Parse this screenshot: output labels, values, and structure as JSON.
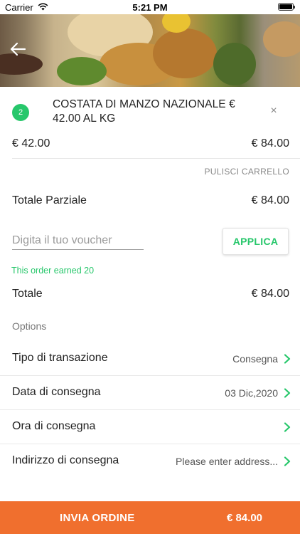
{
  "status_bar": {
    "carrier": "Carrier",
    "time": "5:21 PM"
  },
  "hero": {
    "back_icon": "arrow-left-icon"
  },
  "cart": {
    "items": [
      {
        "quantity": "2",
        "name": "COSTATA DI MANZO NAZIONALE € 42.00 AL KG",
        "unit_price": "€ 42.00",
        "line_total": "€ 84.00"
      }
    ],
    "clear_label": "PULISCI CARRELLO"
  },
  "summary": {
    "subtotal_label": "Totale Parziale",
    "subtotal_value": "€ 84.00",
    "voucher_placeholder": "Digita il tuo voucher",
    "apply_label": "APPLICA",
    "earned_text": "This order earned 20",
    "total_label": "Totale",
    "total_value": "€ 84.00"
  },
  "options": {
    "heading": "Options",
    "rows": [
      {
        "label": "Tipo di transazione",
        "value": "Consegna"
      },
      {
        "label": "Data di consegna",
        "value": "03 Dic,2020"
      },
      {
        "label": "Ora di consegna",
        "value": ""
      },
      {
        "label": "Indirizzo di consegna",
        "value": "Please enter address..."
      }
    ]
  },
  "order_bar": {
    "label": "INVIA ORDINE",
    "total": "€ 84.00"
  },
  "colors": {
    "accent_green": "#27c76b",
    "order_orange": "#f06f2e"
  }
}
